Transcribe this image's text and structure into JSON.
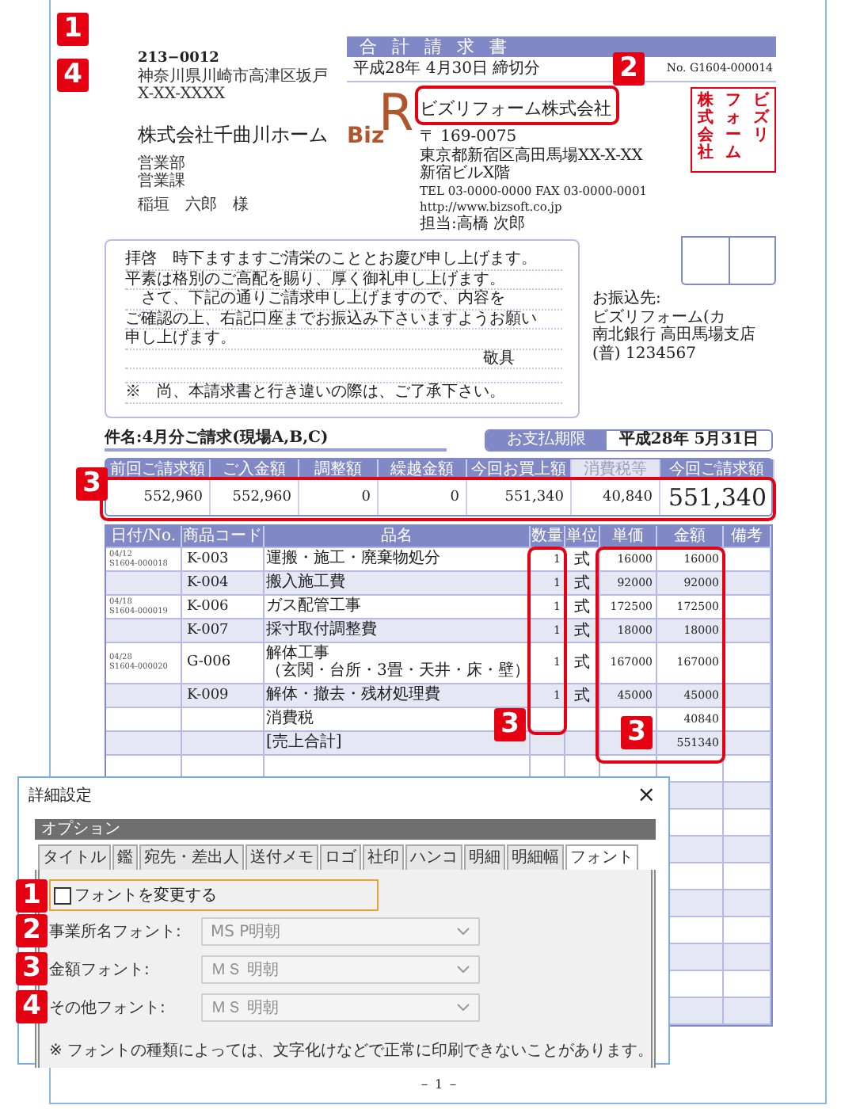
{
  "recipient": {
    "markers": [
      "1",
      "4"
    ],
    "postal_code": "213−0012",
    "address": [
      "神奈川県川崎市高津区坂戸",
      "X-XX-XXXX"
    ],
    "company": "株式会社千曲川ホーム",
    "departments": [
      "営業部",
      "営業課"
    ],
    "person": "稲垣　六郎　様"
  },
  "invoice_header": {
    "title": "合 計 請 求 書",
    "closing_date": "平成28年 4月30日 締切分",
    "number": "No. G1604-000014",
    "marker": "2"
  },
  "sender": {
    "logo": [
      "Biz",
      "R"
    ],
    "company": "ビズリフォーム株式会社",
    "stamp": [
      "株式会社",
      "フォーム",
      "ビズリ"
    ],
    "address": [
      "〒 169-0075",
      "東京都新宿区高田馬場XX-X-XX",
      "新宿ビルX階"
    ],
    "contact": [
      "TEL 03-0000-0000  FAX 03-0000-0001",
      "http://www.bizsoft.co.jp"
    ],
    "staff": "担当:高橋 次郎"
  },
  "letter": {
    "lines": [
      "拝啓　時下ますますご清栄のこととお慶び申し上げます。",
      "平素は格別のご高配を賜り、厚く御礼申し上げます。",
      "　さて、下記の通りご請求申し上げますので、内容を",
      "ご確認の上、右記口座までお振込み下さいますようお願い",
      "申し上げます。"
    ],
    "closing": "敬具",
    "note": "※　尚、本請求書と行き違いの際は、ご了承下さい。"
  },
  "bank": {
    "label": "お振込先:",
    "lines": [
      "ビズリフォーム(カ",
      "南北銀行 高田馬場支店 (普) 1234567"
    ]
  },
  "subject": "件名:4月分ご請求(現場A,B,C)",
  "due": {
    "label": "お支払期限",
    "date": "平成28年 5月31日"
  },
  "summary": {
    "marker": "3",
    "columns": [
      {
        "label": "前回ご請求額",
        "value": "552,960",
        "muted": false
      },
      {
        "label": "ご入金額",
        "value": "552,960",
        "muted": false
      },
      {
        "label": "調整額",
        "value": "0",
        "muted": false
      },
      {
        "label": "繰越金額",
        "value": "0",
        "muted": false
      },
      {
        "label": "今回お買上額",
        "value": "551,340",
        "muted": false
      },
      {
        "label": "消費税等",
        "value": "40,840",
        "muted": true
      },
      {
        "label": "今回ご請求額",
        "value": "551,340",
        "muted": false
      }
    ]
  },
  "items": {
    "markers": [
      "3",
      "3"
    ],
    "columns": [
      "日付/No.",
      "商品コード",
      "品名",
      "数量",
      "単位",
      "単価",
      "金額",
      "備考"
    ],
    "rows": [
      {
        "date": "04/12",
        "slip": "S1604-000018",
        "code": "K-003",
        "name": "運搬・施工・廃棄物処分",
        "qty": "1",
        "unit": "式",
        "price": "16000",
        "amount": "16000"
      },
      {
        "code": "K-004",
        "name": "搬入施工費",
        "qty": "1",
        "unit": "式",
        "price": "92000",
        "amount": "92000"
      },
      {
        "date": "04/18",
        "slip": "S1604-000019",
        "code": "K-006",
        "name": "ガス配管工事",
        "qty": "1",
        "unit": "式",
        "price": "172500",
        "amount": "172500"
      },
      {
        "code": "K-007",
        "name": "採寸取付調整費",
        "qty": "1",
        "unit": "式",
        "price": "18000",
        "amount": "18000"
      },
      {
        "date": "04/28",
        "slip": "S1604-000020",
        "code": "G-006",
        "name": "解体工事",
        "name_detail": "（玄関・台所・3畳・天井・床・壁）",
        "qty": "1",
        "unit": "式",
        "price": "167000",
        "amount": "167000"
      },
      {
        "code": "K-009",
        "name": "解体・撤去・残材処理費",
        "qty": "1",
        "unit": "式",
        "price": "45000",
        "amount": "45000"
      },
      {
        "name": "消費税",
        "amount": "40840"
      },
      {
        "name": "[売上合計]",
        "amount": "551340"
      }
    ]
  },
  "dialog": {
    "title": "詳細設定",
    "close": "×",
    "section": "オプション",
    "tabs": [
      {
        "label": "タイトル",
        "selected": false
      },
      {
        "label": "鑑",
        "selected": false
      },
      {
        "label": "宛先・差出人",
        "selected": false
      },
      {
        "label": "送付メモ",
        "selected": false
      },
      {
        "label": "ロゴ",
        "selected": false
      },
      {
        "label": "社印",
        "selected": false
      },
      {
        "label": "ハンコ",
        "selected": false
      },
      {
        "label": "明細",
        "selected": false
      },
      {
        "label": "明細幅",
        "selected": false
      },
      {
        "label": "フォント",
        "selected": true
      }
    ],
    "checkbox": {
      "marker": "1",
      "label": "フォントを変更する",
      "checked": false
    },
    "fields": [
      {
        "marker": "2",
        "label": "事業所名フォント:",
        "value": "MS P明朝",
        "disabled": true
      },
      {
        "marker": "3",
        "label": "金額フォント:",
        "value": "ＭＳ 明朝",
        "disabled": true
      },
      {
        "marker": "4",
        "label": "その他フォント:",
        "value": "ＭＳ 明朝",
        "disabled": true
      }
    ],
    "note": "※ フォントの種類によっては、文字化けなどで正常に印刷できないことがあります。"
  },
  "page_number": "－ 1 －"
}
